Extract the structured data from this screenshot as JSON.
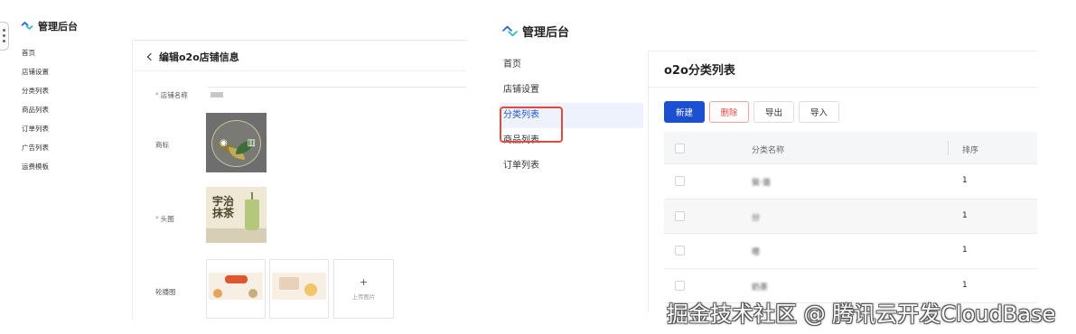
{
  "left_panel": {
    "brand": "管理后台",
    "nav": [
      "首页",
      "店铺设置",
      "分类列表",
      "商品列表",
      "订单列表",
      "广告列表",
      "运费模板"
    ],
    "page_title": "编辑o2o店铺信息",
    "form": {
      "store_name_label": "店铺名称",
      "logo_label": "商标",
      "head_image_label": "头图",
      "carousel_label": "轮播图",
      "required_mark": "*",
      "upload_plus": "+",
      "upload_text": "上传图片",
      "head_image_text": "宇治抹茶"
    }
  },
  "right_panel": {
    "brand": "管理后台",
    "nav": [
      "首页",
      "店铺设置",
      "分类列表",
      "商品列表",
      "订单列表"
    ],
    "active_nav": "分类列表",
    "page_title": "o2o分类列表",
    "toolbar": {
      "new": "新建",
      "delete": "删除",
      "export": "导出",
      "import": "导入"
    },
    "table": {
      "columns": [
        "分类名称",
        "排序"
      ],
      "rows": [
        {
          "name": "奘·谐",
          "sort": "1"
        },
        {
          "name": "分",
          "sort": "1"
        },
        {
          "name": "嗯",
          "sort": "1"
        },
        {
          "name": "奶茶",
          "sort": "1"
        }
      ]
    }
  },
  "watermark": "掘金技术社区 @ 腾讯云开发CloudBase",
  "colors": {
    "primary": "#1d4fd1",
    "danger": "#e34a3f",
    "active_bg": "#edf2fd"
  }
}
